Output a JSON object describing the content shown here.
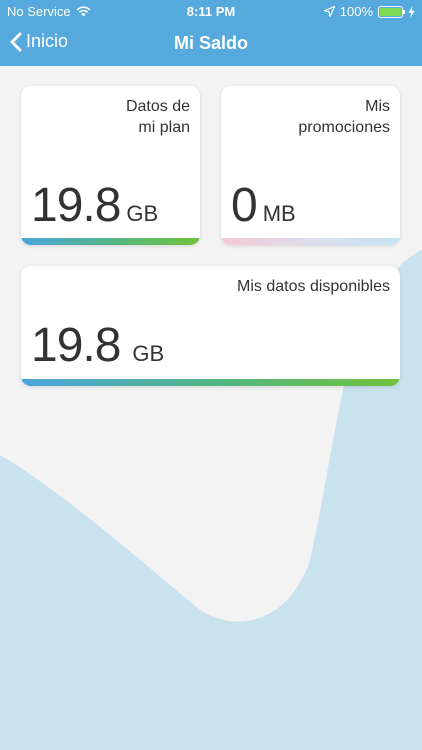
{
  "status_bar": {
    "carrier": "No Service",
    "time": "8:11 PM",
    "battery_percent": "100%",
    "battery_level": 1.0,
    "icons": [
      "wifi-icon",
      "location-arrow-icon",
      "battery-icon",
      "charging-bolt-icon"
    ]
  },
  "nav": {
    "back_label": "Inicio",
    "title": "Mi Saldo"
  },
  "cards": {
    "plan": {
      "label": "Datos de\nmi plan",
      "value": "19.8",
      "unit": "GB"
    },
    "promos": {
      "label": "Mis\npromociones",
      "value": "0",
      "unit": "MB"
    },
    "available": {
      "label": "Mis datos disponibles",
      "value": "19.8",
      "unit": "GB"
    }
  },
  "colors": {
    "header": "#56a9dc",
    "background": "#f3f3f3",
    "wave": "#c9e3ee",
    "bar_green": "#70c13b",
    "bar_blue": "#4aa3dd",
    "bar_pink": "#f5c7d2"
  }
}
